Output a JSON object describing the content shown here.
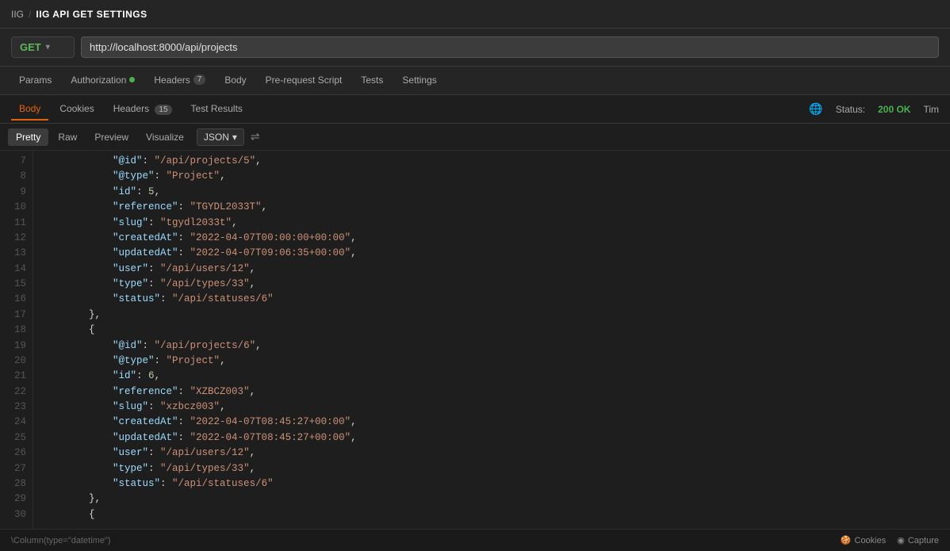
{
  "breadcrumb": {
    "root": "IIG",
    "separator": "/",
    "title": "IIG API GET SETTINGS"
  },
  "url_bar": {
    "method": "GET",
    "url": "http://localhost:8000/api/projects"
  },
  "request_tabs": [
    {
      "id": "params",
      "label": "Params",
      "active": false,
      "badge": null,
      "dot": false
    },
    {
      "id": "authorization",
      "label": "Authorization",
      "active": false,
      "badge": null,
      "dot": true
    },
    {
      "id": "headers",
      "label": "Headers",
      "active": false,
      "badge": "7",
      "dot": false
    },
    {
      "id": "body",
      "label": "Body",
      "active": false,
      "badge": null,
      "dot": false
    },
    {
      "id": "prerequest",
      "label": "Pre-request Script",
      "active": false,
      "badge": null,
      "dot": false
    },
    {
      "id": "tests",
      "label": "Tests",
      "active": false,
      "badge": null,
      "dot": false
    },
    {
      "id": "settings",
      "label": "Settings",
      "active": false,
      "badge": null,
      "dot": false
    }
  ],
  "response_tabs": [
    {
      "id": "body",
      "label": "Body",
      "active": true
    },
    {
      "id": "cookies",
      "label": "Cookies",
      "active": false
    },
    {
      "id": "headers",
      "label": "Headers",
      "badge": "15",
      "active": false
    },
    {
      "id": "test-results",
      "label": "Test Results",
      "active": false
    }
  ],
  "status": {
    "label": "Status:",
    "code": "200",
    "text": "OK",
    "time_label": "Tim"
  },
  "format_bar": {
    "buttons": [
      "Pretty",
      "Raw",
      "Preview",
      "Visualize"
    ],
    "active": "Pretty",
    "format": "JSON"
  },
  "code_lines": [
    {
      "num": 7,
      "content": "            <span class=\"jk\">\"@id\"</span><span class=\"jp\">: </span><span class=\"js\">\"/api/projects/5\"</span><span class=\"jp\">,</span>"
    },
    {
      "num": 8,
      "content": "            <span class=\"jk\">\"@type\"</span><span class=\"jp\">: </span><span class=\"js\">\"Project\"</span><span class=\"jp\">,</span>"
    },
    {
      "num": 9,
      "content": "            <span class=\"jk\">\"id\"</span><span class=\"jp\">: </span><span class=\"jn\">5</span><span class=\"jp\">,</span>"
    },
    {
      "num": 10,
      "content": "            <span class=\"jk\">\"reference\"</span><span class=\"jp\">: </span><span class=\"js\">\"TGYDL2033T\"</span><span class=\"jp\">,</span>"
    },
    {
      "num": 11,
      "content": "            <span class=\"jk\">\"slug\"</span><span class=\"jp\">: </span><span class=\"js\">\"tgydl2033t\"</span><span class=\"jp\">,</span>"
    },
    {
      "num": 12,
      "content": "            <span class=\"jk\">\"createdAt\"</span><span class=\"jp\">: </span><span class=\"js\">\"2022-04-07T00:00:00+00:00\"</span><span class=\"jp\">,</span>"
    },
    {
      "num": 13,
      "content": "            <span class=\"jk\">\"updatedAt\"</span><span class=\"jp\">: </span><span class=\"js\">\"2022-04-07T09:06:35+00:00\"</span><span class=\"jp\">,</span>"
    },
    {
      "num": 14,
      "content": "            <span class=\"jk\">\"user\"</span><span class=\"jp\">: </span><span class=\"js\">\"/api/users/12\"</span><span class=\"jp\">,</span>"
    },
    {
      "num": 15,
      "content": "            <span class=\"jk\">\"type\"</span><span class=\"jp\">: </span><span class=\"js\">\"/api/types/33\"</span><span class=\"jp\">,</span>"
    },
    {
      "num": 16,
      "content": "            <span class=\"jk\">\"status\"</span><span class=\"jp\">: </span><span class=\"js\">\"/api/statuses/6\"</span>"
    },
    {
      "num": 17,
      "content": "        <span class=\"jp\">},</span>"
    },
    {
      "num": 18,
      "content": "        <span class=\"jp\">{</span>"
    },
    {
      "num": 19,
      "content": "            <span class=\"jk\">\"@id\"</span><span class=\"jp\">: </span><span class=\"js\">\"/api/projects/6\"</span><span class=\"jp\">,</span>"
    },
    {
      "num": 20,
      "content": "            <span class=\"jk\">\"@type\"</span><span class=\"jp\">: </span><span class=\"js\">\"Project\"</span><span class=\"jp\">,</span>"
    },
    {
      "num": 21,
      "content": "            <span class=\"jk\">\"id\"</span><span class=\"jp\">: </span><span class=\"jn\">6</span><span class=\"jp\">,</span>"
    },
    {
      "num": 22,
      "content": "            <span class=\"jk\">\"reference\"</span><span class=\"jp\">: </span><span class=\"js\">\"XZBCZ003\"</span><span class=\"jp\">,</span>"
    },
    {
      "num": 23,
      "content": "            <span class=\"jk\">\"slug\"</span><span class=\"jp\">: </span><span class=\"js\">\"xzbcz003\"</span><span class=\"jp\">,</span>"
    },
    {
      "num": 24,
      "content": "            <span class=\"jk\">\"createdAt\"</span><span class=\"jp\">: </span><span class=\"js\">\"2022-04-07T08:45:27+00:00\"</span><span class=\"jp\">,</span>"
    },
    {
      "num": 25,
      "content": "            <span class=\"jk\">\"updatedAt\"</span><span class=\"jp\">: </span><span class=\"js\">\"2022-04-07T08:45:27+00:00\"</span><span class=\"jp\">,</span>"
    },
    {
      "num": 26,
      "content": "            <span class=\"jk\">\"user\"</span><span class=\"jp\">: </span><span class=\"js\">\"/api/users/12\"</span><span class=\"jp\">,</span>"
    },
    {
      "num": 27,
      "content": "            <span class=\"jk\">\"type\"</span><span class=\"jp\">: </span><span class=\"js\">\"/api/types/33\"</span><span class=\"jp\">,</span>"
    },
    {
      "num": 28,
      "content": "            <span class=\"jk\">\"status\"</span><span class=\"jp\">: </span><span class=\"js\">\"/api/statuses/6\"</span>"
    },
    {
      "num": 29,
      "content": "        <span class=\"jp\">},</span>"
    },
    {
      "num": 30,
      "content": "        <span class=\"jp\">{</span>"
    }
  ],
  "bottom_bar": {
    "cookies_label": "Cookies",
    "capture_label": "Capture"
  },
  "footer_text": "\\Column(type=\"datetime\")"
}
